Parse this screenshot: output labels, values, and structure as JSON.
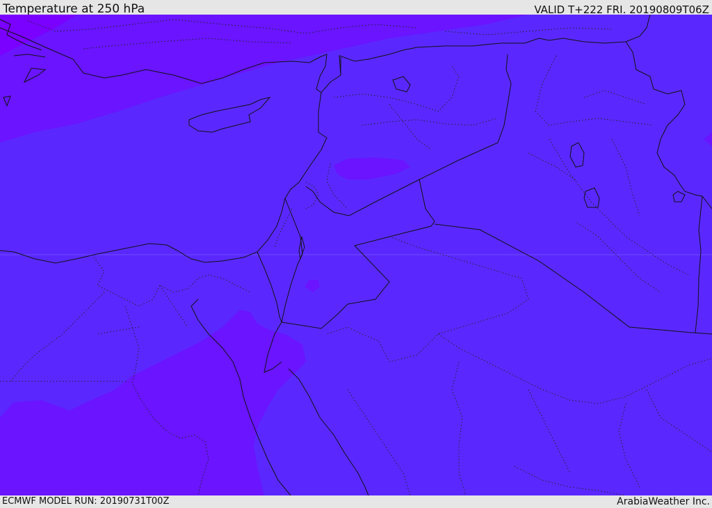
{
  "header": {
    "title": "Temperature at 250 hPa",
    "valid": "VALID T+222 FRI. 20190809T06Z"
  },
  "footer": {
    "model_run": "ECMWF MODEL RUN: 20190731T00Z",
    "brand": "ArabiaWeather Inc."
  },
  "colors": {
    "background_field": "#5a28ff",
    "warm_patch": "#6a14ff",
    "cold_patch": "#7a00ff",
    "coast_line": "#111111"
  }
}
